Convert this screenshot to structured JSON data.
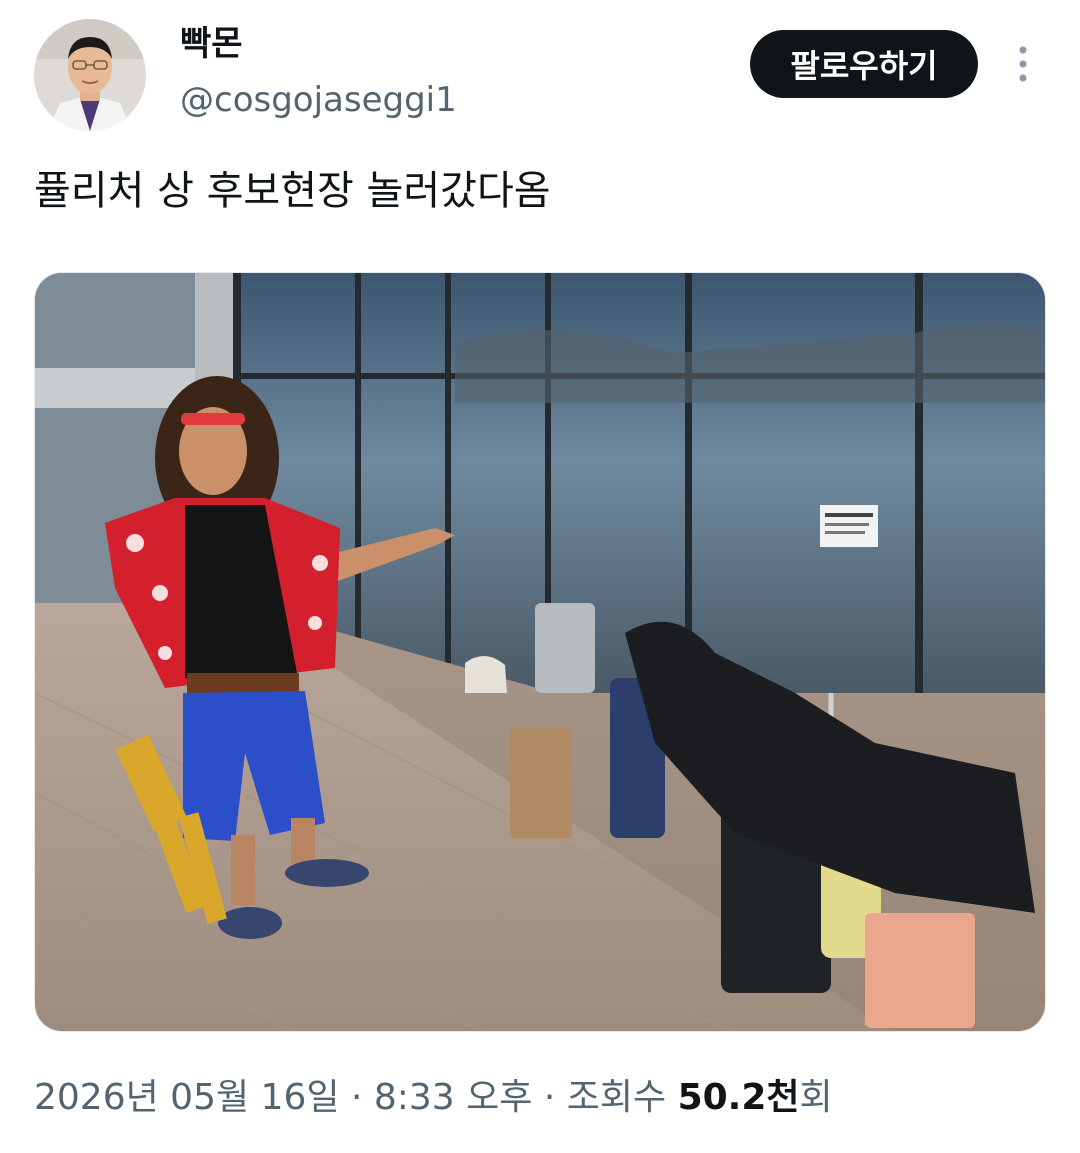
{
  "author": {
    "display_name": "빡몬",
    "handle": "@cosgojaseggi1",
    "avatar_icon": "profile-photo"
  },
  "follow_button": {
    "label": "팔로우하기"
  },
  "more_button": {
    "icon": "vertical-ellipsis-icon"
  },
  "tweet": {
    "text": "퓰리처 상 후보현장 놀러갔다옴"
  },
  "media": {
    "image_icon": "photo"
  },
  "meta": {
    "date": "2026년 05월 16일",
    "separator": "·",
    "time": "8:33 오후",
    "views_label": "조회수",
    "views_value": "50.2천",
    "views_suffix": "회"
  },
  "colors": {
    "primary_text": "#0f1419",
    "secondary_text": "#536471",
    "button_bg": "#0f1419"
  }
}
